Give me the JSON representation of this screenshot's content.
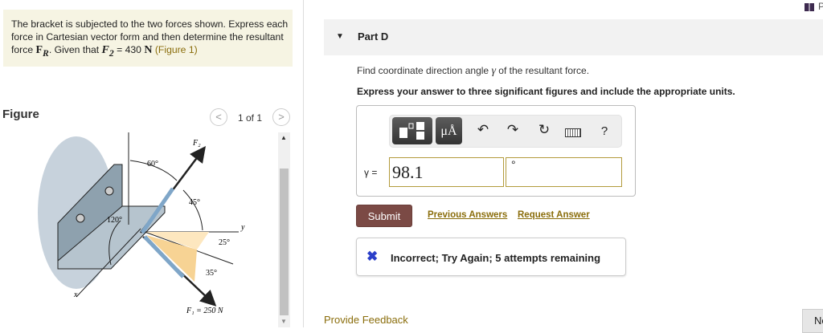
{
  "problem": {
    "text_1": "The bracket is subjected to the two forces shown. Express each force in Cartesian vector form and then determine the resultant force ",
    "fr": "F",
    "fr_sub": "R",
    "text_2": ". Given that ",
    "f2": "F",
    "f2_sub": "2",
    "text_3": " = 430 ",
    "unit": "N",
    "figure_link": "(Figure 1)"
  },
  "figure": {
    "heading": "Figure",
    "pager": "1 of 1",
    "prev": "<",
    "next": ">",
    "labels": {
      "f2": "F₂",
      "f1": "F₁ = 250 N",
      "a60": "60°",
      "a45": "45°",
      "a120": "120°",
      "a25": "25°",
      "a35": "35°",
      "x": "x",
      "y": "y"
    }
  },
  "header": {
    "top_right_text": "P"
  },
  "part": {
    "title": "Part D"
  },
  "question": {
    "text_1": "Find coordinate direction angle ",
    "symbol": "γ",
    "text_2": " of the resultant force.",
    "instructions": "Express your answer to three significant figures and include the appropriate units."
  },
  "answer": {
    "toolbar": {
      "units": "μÅ",
      "help": "?"
    },
    "label": "γ =",
    "value": "98.1",
    "unit": "°"
  },
  "actions": {
    "submit": "Submit",
    "previous_answers": "Previous Answers",
    "request_answer": "Request Answer"
  },
  "feedback": {
    "icon": "✖",
    "message": "Incorrect; Try Again; 5 attempts remaining"
  },
  "footer": {
    "provide_feedback": "Provide Feedback",
    "next": "Ne"
  },
  "colors": {
    "submit": "#7b4a45",
    "link": "#8a6d0b",
    "incorrect_icon": "#2b3fc9",
    "problem_bg": "#f6f4e3"
  }
}
